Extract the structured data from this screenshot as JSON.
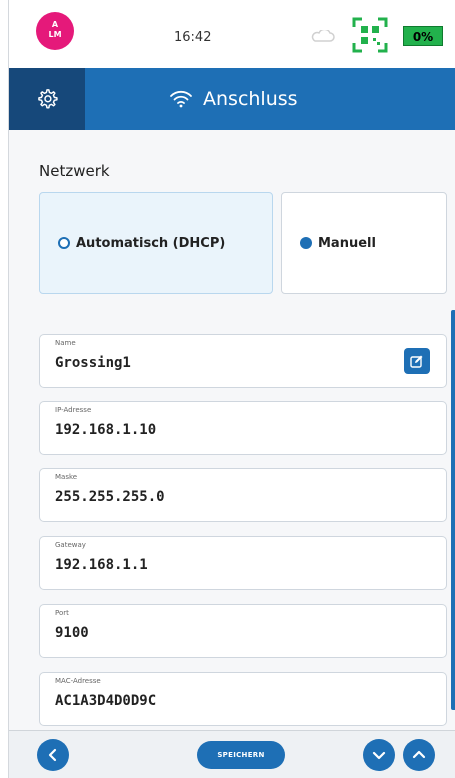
{
  "status_bar": {
    "avatar_top": "A",
    "avatar_bottom": "LM",
    "time": "16:42",
    "battery": "0%",
    "icons": [
      "cloud-icon",
      "qr-scan-icon",
      "battery-icon"
    ]
  },
  "header": {
    "title": "Anschluss",
    "icons": [
      "settings-gear-icon",
      "wifi-icon"
    ]
  },
  "network": {
    "section_label": "Netzwerk",
    "options": [
      {
        "label": "Automatisch (DHCP)",
        "selected": true
      },
      {
        "label": "Manuell",
        "selected": false
      }
    ]
  },
  "fields": [
    {
      "label": "Name",
      "value": "Grossing1",
      "editable": true
    },
    {
      "label": "IP-Adresse",
      "value": "192.168.1.10",
      "editable": false
    },
    {
      "label": "Maske",
      "value": "255.255.255.0",
      "editable": false
    },
    {
      "label": "Gateway",
      "value": "192.168.1.1",
      "editable": false
    },
    {
      "label": "Port",
      "value": "9100",
      "editable": false
    },
    {
      "label": "MAC-Adresse",
      "value": "AC1A3D4D0D9C",
      "editable": false
    }
  ],
  "footer": {
    "save_label": "SPEICHERN",
    "icons": [
      "back-icon",
      "scroll-down-icon",
      "scroll-up-icon"
    ]
  },
  "colors": {
    "primary": "#1e6fb5",
    "header_dark": "#16487a",
    "avatar": "#e5197a",
    "battery": "#22b14c",
    "selected_card": "#eaf4fb"
  }
}
